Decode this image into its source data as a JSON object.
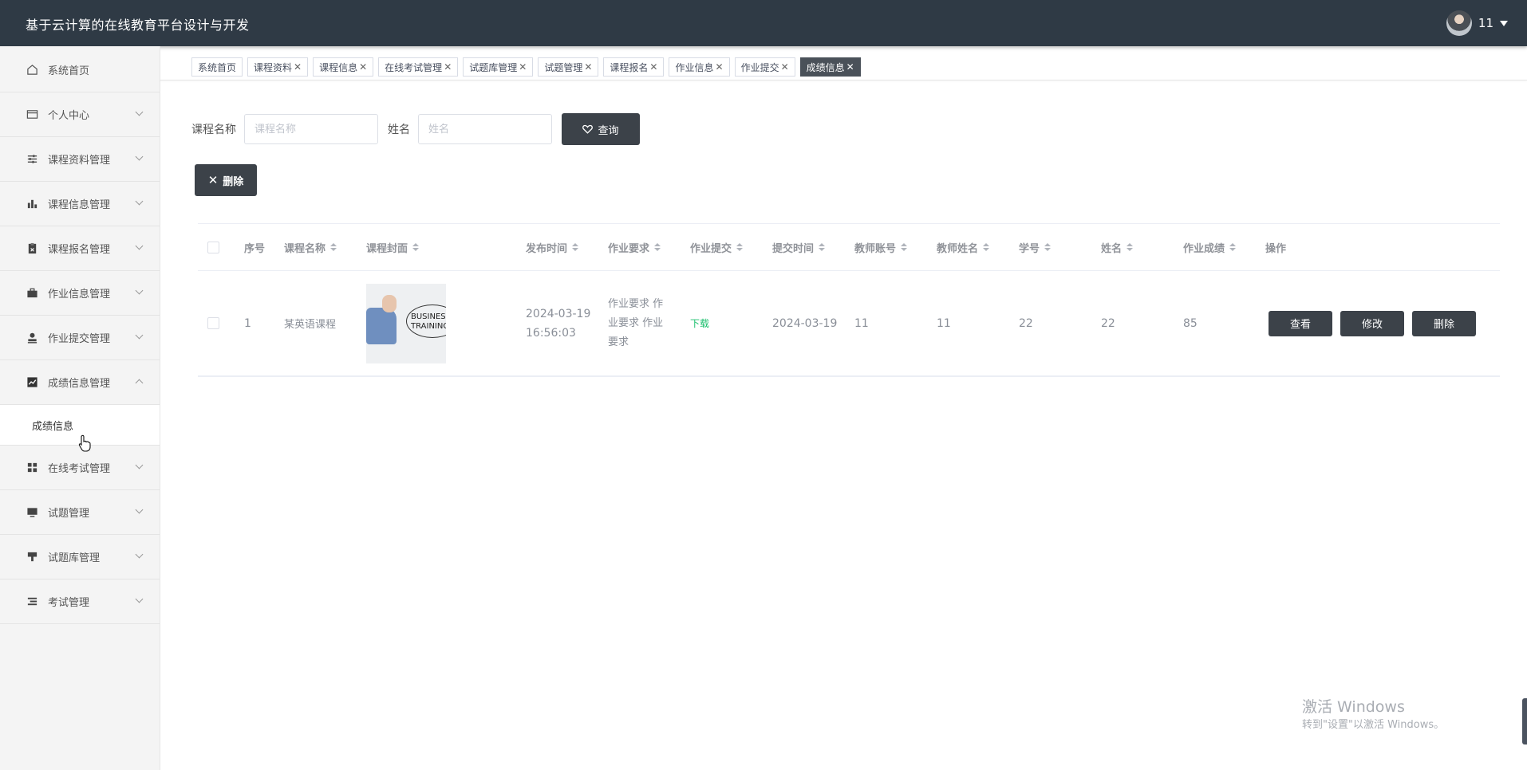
{
  "header": {
    "title": "基于云计算的在线教育平台设计与开发",
    "username": "11"
  },
  "sidebar": {
    "items": [
      {
        "label": "系统首页",
        "icon": "home-icon",
        "arrow": ""
      },
      {
        "label": "个人中心",
        "icon": "id-card-icon",
        "arrow": "down"
      },
      {
        "label": "课程资料管理",
        "icon": "sliders-icon",
        "arrow": "down"
      },
      {
        "label": "课程信息管理",
        "icon": "bar-chart-icon",
        "arrow": "down"
      },
      {
        "label": "课程报名管理",
        "icon": "clipboard-icon",
        "arrow": "down"
      },
      {
        "label": "作业信息管理",
        "icon": "briefcase-icon",
        "arrow": "down"
      },
      {
        "label": "作业提交管理",
        "icon": "user-stamp-icon",
        "arrow": "down"
      },
      {
        "label": "成绩信息管理",
        "icon": "line-chart-icon",
        "arrow": "up"
      }
    ],
    "submenu": {
      "label": "成绩信息"
    },
    "items_after": [
      {
        "label": "在线考试管理",
        "icon": "grid-icon"
      },
      {
        "label": "试题管理",
        "icon": "monitor-icon"
      },
      {
        "label": "试题库管理",
        "icon": "paint-roller-icon"
      },
      {
        "label": "考试管理",
        "icon": "list-icon"
      }
    ]
  },
  "tabs": [
    {
      "label": "系统首页",
      "closable": false
    },
    {
      "label": "课程资料",
      "closable": true
    },
    {
      "label": "课程信息",
      "closable": true
    },
    {
      "label": "在线考试管理",
      "closable": true
    },
    {
      "label": "试题库管理",
      "closable": true
    },
    {
      "label": "试题管理",
      "closable": true
    },
    {
      "label": "课程报名",
      "closable": true
    },
    {
      "label": "作业信息",
      "closable": true
    },
    {
      "label": "作业提交",
      "closable": true
    },
    {
      "label": "成绩信息",
      "closable": true,
      "active": true
    }
  ],
  "search": {
    "course_label": "课程名称",
    "course_placeholder": "课程名称",
    "name_label": "姓名",
    "name_placeholder": "姓名",
    "query_label": "查询"
  },
  "toolbar": {
    "delete_label": "删除"
  },
  "table": {
    "columns": [
      "序号",
      "课程名称",
      "课程封面",
      "发布时间",
      "作业要求",
      "作业提交",
      "提交时间",
      "教师账号",
      "教师姓名",
      "学号",
      "姓名",
      "作业成绩",
      "操作"
    ],
    "rows": [
      {
        "index": "1",
        "course_name": "某英语课程",
        "cover_text": "BUSINESS TRAINING",
        "publish_time": "2024-03-19 16:56:03",
        "requirement": "作业要求 作业要求 作业要求",
        "submission": "下载",
        "submit_time": "2024-03-19",
        "teacher_account": "11",
        "teacher_name": "11",
        "student_id": "22",
        "student_name": "22",
        "score": "85",
        "actions": {
          "view": "查看",
          "edit": "修改",
          "delete": "删除"
        }
      }
    ]
  },
  "watermark": {
    "line1": "激活 Windows",
    "line2": "转到\"设置\"以激活 Windows。"
  },
  "colors": {
    "header_bg": "#2f3a45",
    "button_dark": "#3c4249",
    "download_green": "#19be6b"
  }
}
